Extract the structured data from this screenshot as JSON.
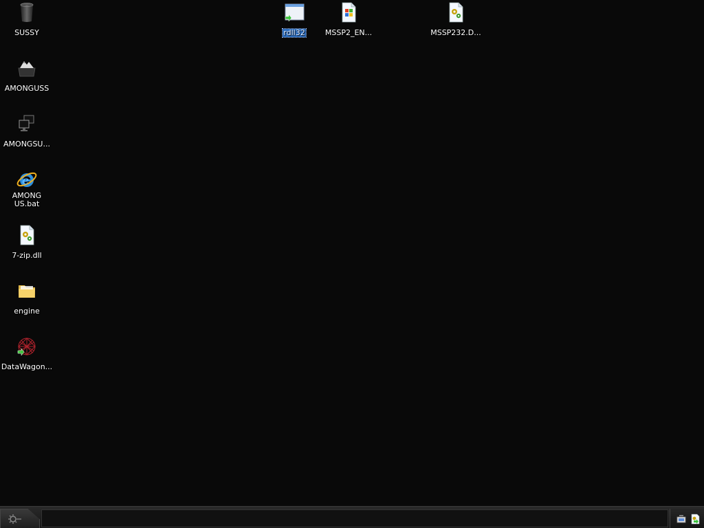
{
  "desktop": {
    "icons": [
      {
        "label": "SUSSY",
        "icon": "recycle-bin-icon"
      },
      {
        "label": "AMONGUSS",
        "icon": "drive-icon"
      },
      {
        "label": "AMONGSU...",
        "icon": "network-icon"
      },
      {
        "label": "AMONG US.bat",
        "icon": "internet-explorer-icon"
      },
      {
        "label": "7-zip.dll",
        "icon": "dll-file-icon"
      },
      {
        "label": "engine",
        "icon": "folder-icon"
      },
      {
        "label": "DataWagon...",
        "icon": "data-wagon-icon"
      },
      {
        "label": "rdll32",
        "icon": "application-window-icon",
        "selected": true
      },
      {
        "label": "MSSP2_EN...",
        "icon": "windows-file-icon"
      },
      {
        "label": "MSSP232.D...",
        "icon": "dll-file-icon"
      }
    ]
  },
  "taskbar": {
    "start_icon": "start-orb-icon",
    "tray_icons": [
      "network-tray-icon",
      "update-tray-icon"
    ]
  },
  "colors": {
    "desktop_background": "#090909",
    "selection": "#2f6fbf",
    "taskbar": "#1f1f1f"
  }
}
